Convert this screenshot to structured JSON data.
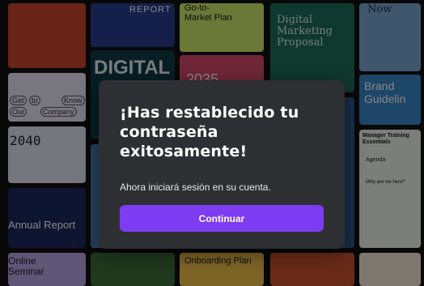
{
  "modal": {
    "title": "¡Has restablecido tu contraseña exitosamente!",
    "message": "Ahora iniciará sesión en su cuenta.",
    "button_label": "Continuar",
    "accent_color": "#7d3cf2",
    "background_color": "#2e2f33"
  },
  "background_tiles": {
    "report": "REPORT",
    "market_plan": "Go-to-\nMarket Plan",
    "digital_marketing": "Digital\nMarketing\nProposal",
    "now": "Now",
    "digital": "DIGITAL",
    "year_2035": "2035",
    "brand_guidelines": "Brand\nGuidelin",
    "get_to_know": [
      "Get",
      "to",
      "Know",
      "Our",
      "Company"
    ],
    "year_2040": "2040",
    "manager_training": "Manager Training\nEssentials",
    "agenda": "Agenda",
    "why_here": "Why are we here?",
    "annual_report": "Annual Report",
    "onboarding_plan": "Onboarding Plan",
    "online_seminar": "Online\nSeminar"
  }
}
